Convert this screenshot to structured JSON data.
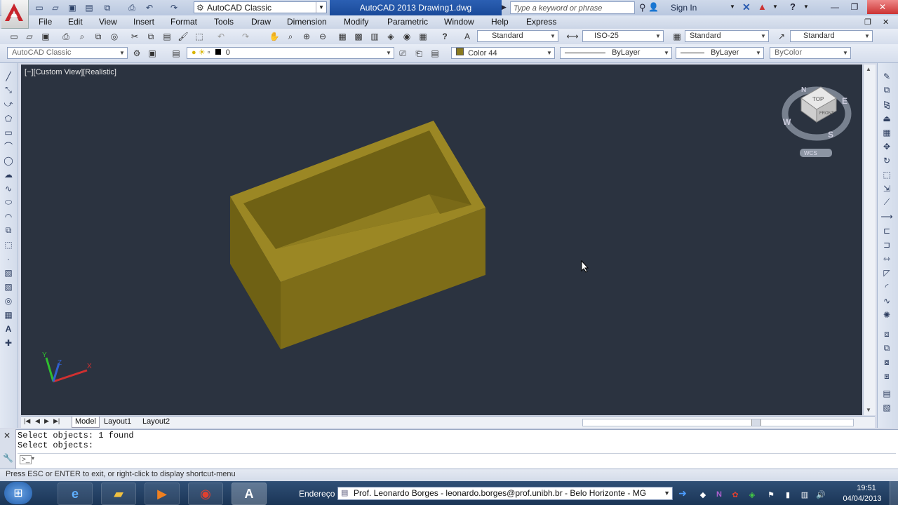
{
  "window": {
    "title": "AutoCAD 2013    Drawing1.dwg",
    "workspace": "AutoCAD Classic",
    "search_placeholder": "Type a keyword or phrase",
    "sign_in": "Sign In"
  },
  "menu": [
    "File",
    "Edit",
    "View",
    "Insert",
    "Format",
    "Tools",
    "Draw",
    "Dimension",
    "Modify",
    "Parametric",
    "Window",
    "Help",
    "Express"
  ],
  "toolbar1": {
    "text_style": "Standard",
    "dim_style": "ISO-25",
    "table_style": "Standard",
    "mleader_style": "Standard"
  },
  "toolbar2": {
    "workspace": "AutoCAD Classic",
    "layer": "0",
    "color": "Color 44",
    "linetype": "ByLayer",
    "lineweight": "ByLayer",
    "plotstyle": "ByColor"
  },
  "viewport": {
    "label": "[−][Custom View][Realistic]",
    "viewcube": {
      "top": "TOP",
      "front": "FRONT",
      "n": "N",
      "s": "S",
      "e": "E",
      "w": "W",
      "wcs": "WCS"
    },
    "ucs": {
      "x": "X",
      "y": "Y",
      "z": "Z"
    }
  },
  "layout_tabs": [
    "Model",
    "Layout1",
    "Layout2"
  ],
  "command": {
    "lines": [
      "Select objects: 1 found",
      "Select objects:"
    ],
    "input_placeholder": ""
  },
  "status": "Press ESC or ENTER to exit, or right-click to display shortcut-menu",
  "taskbar": {
    "address_label": "Endereço",
    "address_value": "Prof. Leonardo Borges - leonardo.borges@prof.unibh.br - Belo Horizonte - MG",
    "time": "19:51",
    "date": "04/04/2013"
  },
  "colors": {
    "object": "#8a7a1e",
    "object_top": "#a08c25",
    "object_inner": "#6f6114",
    "viewport_bg": "#2b3340"
  }
}
